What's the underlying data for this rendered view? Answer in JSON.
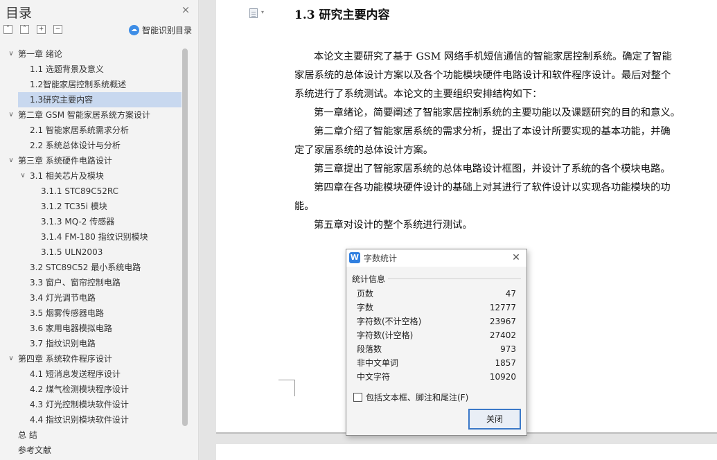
{
  "nav": {
    "title": "目录",
    "close_icon": "×",
    "toolbar_icons": [
      "collapse-all-icon",
      "expand-icon",
      "add-level-icon",
      "remove-level-icon"
    ],
    "smart_toc_label": "智能识别目录",
    "items": [
      {
        "label": "第一章  绪论",
        "level": 0,
        "expanded": true
      },
      {
        "label": "1.1 选题背景及意义",
        "level": 1
      },
      {
        "label": "1.2智能家居控制系统概述",
        "level": 1
      },
      {
        "label": "1.3研究主要内容",
        "level": 1,
        "selected": true
      },
      {
        "label": "第二章  GSM 智能家居系统方案设计",
        "level": 0,
        "expanded": true
      },
      {
        "label": "2.1  智能家居系统需求分析",
        "level": 1
      },
      {
        "label": "2.2  系统总体设计与分析",
        "level": 1
      },
      {
        "label": "第三章  系统硬件电路设计",
        "level": 0,
        "expanded": true
      },
      {
        "label": "3.1  相关芯片及模块",
        "level": 1,
        "expanded": true
      },
      {
        "label": "3.1.1 STC89C52RC",
        "level": 2
      },
      {
        "label": "3.1.2 TC35i 模块",
        "level": 2
      },
      {
        "label": "3.1.3 MQ-2 传感器",
        "level": 2
      },
      {
        "label": "3.1.4 FM-180 指纹识别模块",
        "level": 2
      },
      {
        "label": "3.1.5 ULN2003",
        "level": 2
      },
      {
        "label": "3.2 STC89C52 最小系统电路",
        "level": 1
      },
      {
        "label": "3.3  窗户、窗帘控制电路",
        "level": 1
      },
      {
        "label": "3.4  灯光调节电路",
        "level": 1
      },
      {
        "label": "3.5  烟雾传感器电路",
        "level": 1
      },
      {
        "label": "3.6  家用电器模拟电路",
        "level": 1
      },
      {
        "label": "3.7  指纹识别电路",
        "level": 1
      },
      {
        "label": "第四章  系统软件程序设计",
        "level": 0,
        "expanded": true
      },
      {
        "label": "4.1  短消息发送程序设计",
        "level": 1
      },
      {
        "label": "4.2  煤气检测模块程序设计",
        "level": 1
      },
      {
        "label": "4.3  灯光控制模块软件设计",
        "level": 1
      },
      {
        "label": "4.4  指纹识别模块软件设计",
        "level": 1
      },
      {
        "label": "总    结",
        "level": 0
      },
      {
        "label": "参考文献",
        "level": 0
      }
    ]
  },
  "document": {
    "heading": "1.3  研究主要内容",
    "lines": [
      "本论文主要研究了基于 GSM 网络手机短信通信的智能家居控制系统。确定了智能",
      "家居系统的总体设计方案以及各个功能模块硬件电路设计和软件程序设计。最后对整个",
      "系统进行了系统测试。本论文的主要组织安排结构如下：",
      "第一章绪论，简要阐述了智能家居控制系统的主要功能以及课题研究的目的和意义。",
      "第二章介绍了智能家居系统的需求分析，提出了本设计所要实现的基本功能，并确",
      "定了家居系统的总体设计方案。",
      "第三章提出了智能家居系统的总体电路设计框图，并设计了系统的各个模块电路。",
      "第四章在各功能模块硬件设计的基础上对其进行了软件设计以实现各功能模块的功",
      "能。",
      "第五章对设计的整个系统进行测试。"
    ]
  },
  "word_count": {
    "logo": "W",
    "title": "字数统计",
    "group_label": "统计信息",
    "stats": [
      {
        "label": "页数",
        "value": "47"
      },
      {
        "label": "字数",
        "value": "12777"
      },
      {
        "label": "字符数(不计空格)",
        "value": "23967"
      },
      {
        "label": "字符数(计空格)",
        "value": "27402"
      },
      {
        "label": "段落数",
        "value": "973"
      },
      {
        "label": "非中文单词",
        "value": "1857"
      },
      {
        "label": "中文字符",
        "value": "10920"
      }
    ],
    "include_label": "包括文本框、脚注和尾注(F)",
    "include_checked": false,
    "close_button": "关闭"
  }
}
